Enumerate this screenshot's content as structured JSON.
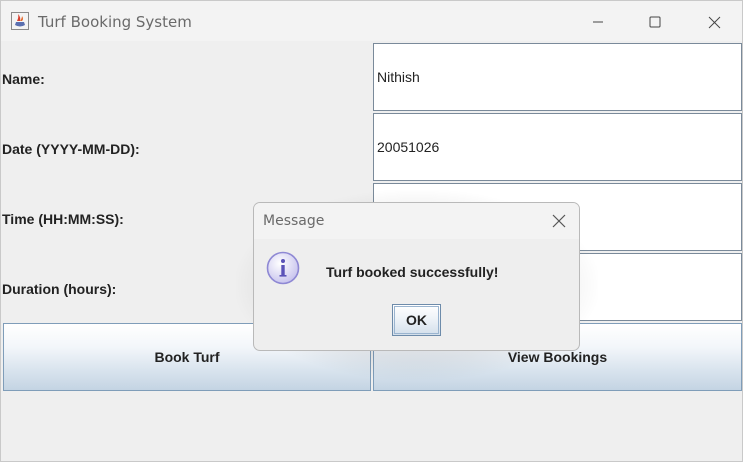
{
  "window": {
    "title": "Turf Booking System",
    "icon": "java-coffee-icon"
  },
  "form": {
    "fields": [
      {
        "label": "Name:",
        "value": "Nithish"
      },
      {
        "label": "Date (YYYY-MM-DD):",
        "value": "20051026"
      },
      {
        "label": "Time (HH:MM:SS):",
        "value": ""
      },
      {
        "label": "Duration (hours):",
        "value": ""
      }
    ],
    "book_label": "Book Turf",
    "view_label": "View Bookings"
  },
  "dialog": {
    "title": "Message",
    "message": "Turf booked successfully!",
    "ok_label": "OK",
    "icon": "info-icon"
  },
  "colors": {
    "window_bg": "#efefef",
    "button_border": "#7f9db9",
    "field_border": "#7a8a9a",
    "info_icon": "#8e88d4"
  }
}
